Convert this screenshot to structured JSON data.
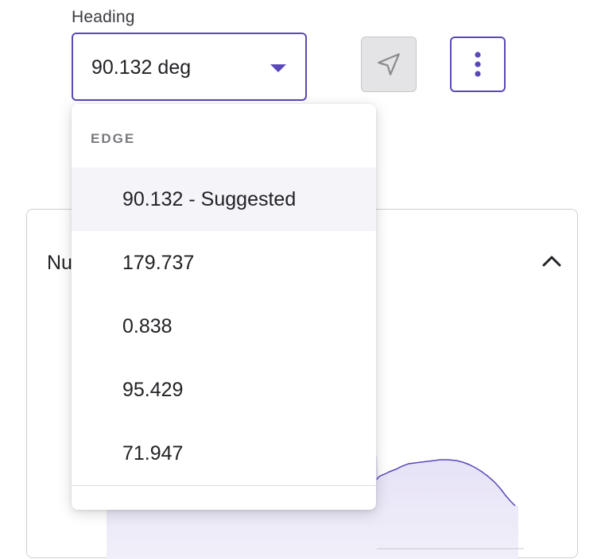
{
  "heading_field": {
    "label": "Heading",
    "value": "90.132 deg"
  },
  "toolbar": {
    "locate_icon": "navigation-arrow-icon",
    "more_icon": "more-vertical-icon"
  },
  "panel": {
    "title_visible": "Nu",
    "collapse_icon": "chevron-up-icon"
  },
  "dropdown": {
    "group_label": "EDGE",
    "options": [
      {
        "label": "90.132 - Suggested",
        "active": true
      },
      {
        "label": "179.737",
        "active": false
      },
      {
        "label": "0.838",
        "active": false
      },
      {
        "label": "95.429",
        "active": false
      },
      {
        "label": "71.947",
        "active": false
      }
    ]
  },
  "colors": {
    "accent": "#5a48b8",
    "area_fill": "#ece9f8",
    "line": "#5a48b8",
    "active_option_bg": "#f5f4f9"
  }
}
